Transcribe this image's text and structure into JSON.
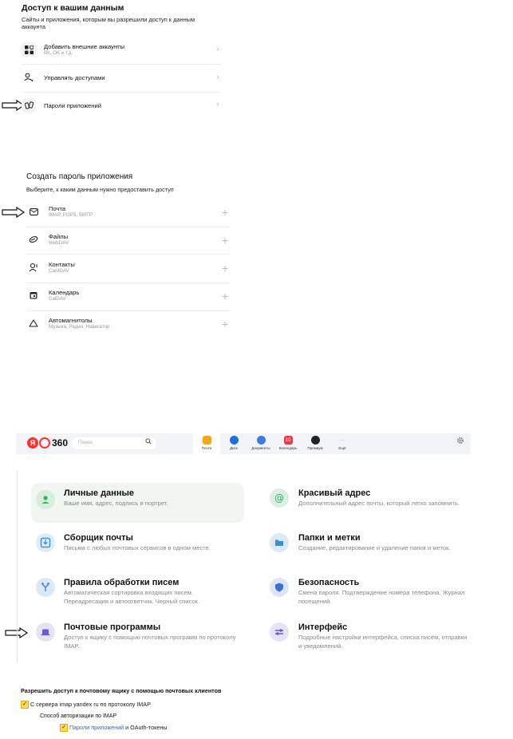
{
  "access": {
    "title": "Доступ к вашим данным",
    "description": "Сайты и приложения, которым вы разрешили доступ к данным аккаунта",
    "items": [
      {
        "label": "Добавить внешние аккаунты",
        "sub": "ВК, OK и т.д."
      },
      {
        "label": "Управлять доступами",
        "sub": ""
      },
      {
        "label": "Пароли приложений",
        "sub": ""
      }
    ],
    "chevron": "›"
  },
  "create": {
    "title": "Создать пароль приложения",
    "description": "Выберите, к каким данным нужно предоставить доступ",
    "plus": "+",
    "items": [
      {
        "label": "Почта",
        "sub": "IMAP, POP3, SMTP"
      },
      {
        "label": "Файлы",
        "sub": "WebDAV"
      },
      {
        "label": "Контакты",
        "sub": "CardDAV"
      },
      {
        "label": "Календарь",
        "sub": "CalDAV"
      },
      {
        "label": "Автомагнитолы",
        "sub": "Музыка, Радио, Навигатор"
      }
    ]
  },
  "topbar": {
    "logo_letter": "Я",
    "logo_number": "360",
    "search_placeholder": "Поиск",
    "apps": [
      {
        "label": "Почта",
        "color": "#f5a623",
        "badge": ""
      },
      {
        "label": "Диск",
        "color": "#1e6fe0",
        "badge": ""
      },
      {
        "label": "Документы",
        "color": "#3b7ddd",
        "badge": ""
      },
      {
        "label": "Календарь",
        "color": "#e93c4a",
        "badge": "10"
      },
      {
        "label": "Премиум",
        "color": "#222222",
        "badge": ""
      },
      {
        "label": "Ещё",
        "color": "",
        "badge": ""
      }
    ],
    "more_glyph": "···"
  },
  "settings": {
    "cards": [
      {
        "title": "Личные данные",
        "desc": "Ваше имя, адрес, подпись и портрет.",
        "color": "#3cab5a",
        "icon": "person-icon"
      },
      {
        "title": "Красивый адрес",
        "desc": "Дополнительный адрес почты, который легко запомнить.",
        "color": "#2fae6b",
        "icon": "at-icon"
      },
      {
        "title": "Сборщик почты",
        "desc": "Письма с любых почтовых сервисов в одном месте.",
        "color": "#3a9ad9",
        "icon": "inbox-download-icon"
      },
      {
        "title": "Папки и метки",
        "desc": "Создание, редактирование и удаление папок и меток.",
        "color": "#3a8fd6",
        "icon": "folder-icon"
      },
      {
        "title": "Правила обработки писем",
        "desc": "Автоматическая сортировка входящих писем. Переадресация и автоответчик. Черный список.",
        "color": "#3c86d6",
        "icon": "branch-icon"
      },
      {
        "title": "Безопасность",
        "desc": "Смена пароля. Подтверждение номера телефона. Журнал посещений.",
        "color": "#3c6ed8",
        "icon": "shield-icon"
      },
      {
        "title": "Почтовые программы",
        "desc": "Доступ к ящику с помощью почтовых программ по протоколу IMAP.",
        "color": "#6a5ad6",
        "icon": "laptop-icon"
      },
      {
        "title": "Интерфейс",
        "desc": "Подробные настройки интерфейса, списка писем, отправки и уведомлений.",
        "color": "#6a5ad6",
        "icon": "sliders-icon"
      }
    ]
  },
  "imap": {
    "title": "Разрешить доступ к почтовому ящику с помощью почтовых клиентов",
    "option1": "С сервера imap yandex ru по протоколу IMAP",
    "subtitle": "Способ авторизации по IMAP",
    "link": "Пароли приложений",
    "suffix": " и OAuth-токены"
  }
}
